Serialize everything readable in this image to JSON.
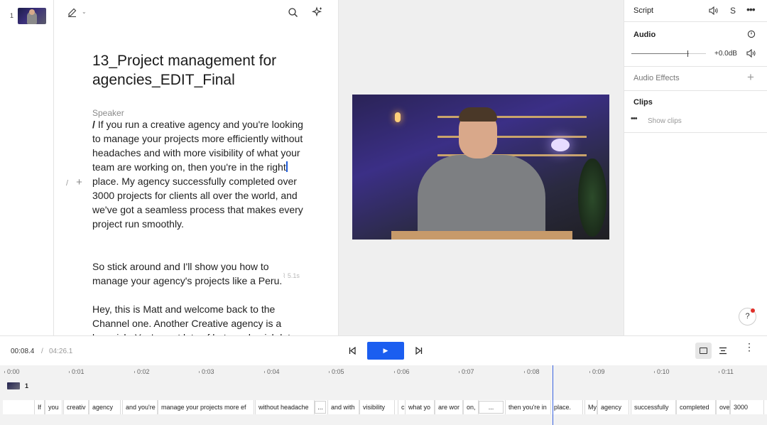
{
  "scenes_sidebar": {
    "items": [
      {
        "number": "1"
      }
    ]
  },
  "editor": {
    "title": "13_Project management for agencies_EDIT_Final",
    "speaker": "Speaker",
    "para1_start": "If you run a creative agency and you're looking to manage your projects more efficiently without headaches and with more visibility of what your team are working on, then you're in the right",
    "para1_end": "place. My agency successfully completed over 3000 projects for clients all over the world, and we've got a seamless process that makes every project run smoothly.",
    "para2": "So stick around and I'll show you how to manage your agency's projects like a Peru.",
    "pause_label": "5.1s",
    "para3": "Hey, this is Matt and welcome back to the Channel one. Another Creative agency is a lunnnish. You've got lots of bats and nnish lots of",
    "line_tools_slash": "/",
    "line_tools_plus": "+"
  },
  "right_panel": {
    "script_label": "Script",
    "script_s_label": "S",
    "audio_label": "Audio",
    "audio_db": "+0.0dB",
    "audio_effects_label": "Audio Effects",
    "clips_label": "Clips",
    "show_clips_label": "Show clips",
    "help_label": "?"
  },
  "transport": {
    "current_time": "00:08.4",
    "separator": "/",
    "total_time": "04:26.1"
  },
  "timeline": {
    "ruler": [
      "0:00",
      "0:01",
      "0:02",
      "0:03",
      "0:04",
      "0:05",
      "0:06",
      "0:07",
      "0:08",
      "0:09",
      "0:10",
      "0:11"
    ],
    "scene_number": "1",
    "words": [
      "If",
      "you",
      "creativ",
      "agency",
      "and you're",
      "manage your projects more ef",
      "without headache",
      "...",
      "and with",
      "visibility",
      "c",
      "what yo",
      "are wor",
      "on,",
      "...",
      "then you're in",
      "place.",
      "My",
      "agency",
      "successfully",
      "completed",
      "ove",
      "3000"
    ]
  },
  "colors": {
    "accent": "#1b5ef0",
    "playhead": "#3a63e0",
    "help_dot": "#e0302a"
  }
}
